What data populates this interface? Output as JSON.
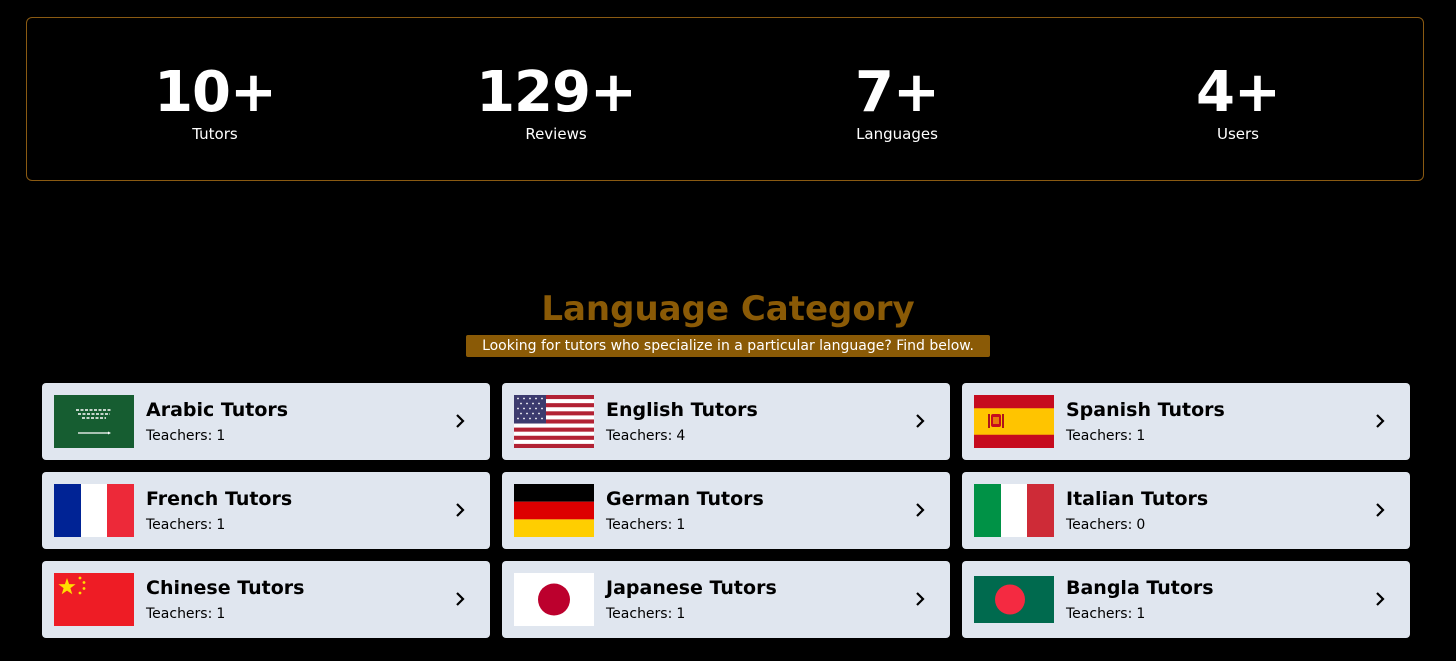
{
  "stats": [
    {
      "value": "10+",
      "label": "Tutors"
    },
    {
      "value": "129+",
      "label": "Reviews"
    },
    {
      "value": "7+",
      "label": "Languages"
    },
    {
      "value": "4+",
      "label": "Users"
    }
  ],
  "category": {
    "title": "Language Category",
    "subtitle": "Looking for tutors who specialize in a particular language? Find below."
  },
  "cards": [
    {
      "title": "Arabic Tutors",
      "teachers_label": "Teachers:",
      "teachers": "1",
      "flag": "saudi-arabia-flag-icon"
    },
    {
      "title": "English Tutors",
      "teachers_label": "Teachers:",
      "teachers": "4",
      "flag": "usa-flag-icon"
    },
    {
      "title": "Spanish Tutors",
      "teachers_label": "Teachers:",
      "teachers": "1",
      "flag": "spain-flag-icon"
    },
    {
      "title": "French Tutors",
      "teachers_label": "Teachers:",
      "teachers": "1",
      "flag": "france-flag-icon"
    },
    {
      "title": "German Tutors",
      "teachers_label": "Teachers:",
      "teachers": "1",
      "flag": "germany-flag-icon"
    },
    {
      "title": "Italian Tutors",
      "teachers_label": "Teachers:",
      "teachers": "0",
      "flag": "italy-flag-icon"
    },
    {
      "title": "Chinese Tutors",
      "teachers_label": "Teachers:",
      "teachers": "1",
      "flag": "china-flag-icon"
    },
    {
      "title": "Japanese Tutors",
      "teachers_label": "Teachers:",
      "teachers": "1",
      "flag": "japan-flag-icon"
    },
    {
      "title": "Bangla Tutors",
      "teachers_label": "Teachers:",
      "teachers": "1",
      "flag": "bangladesh-flag-icon"
    }
  ],
  "colors": {
    "background": "#000000",
    "accent": "#8a5a06",
    "card_background": "#e0e6ef"
  }
}
